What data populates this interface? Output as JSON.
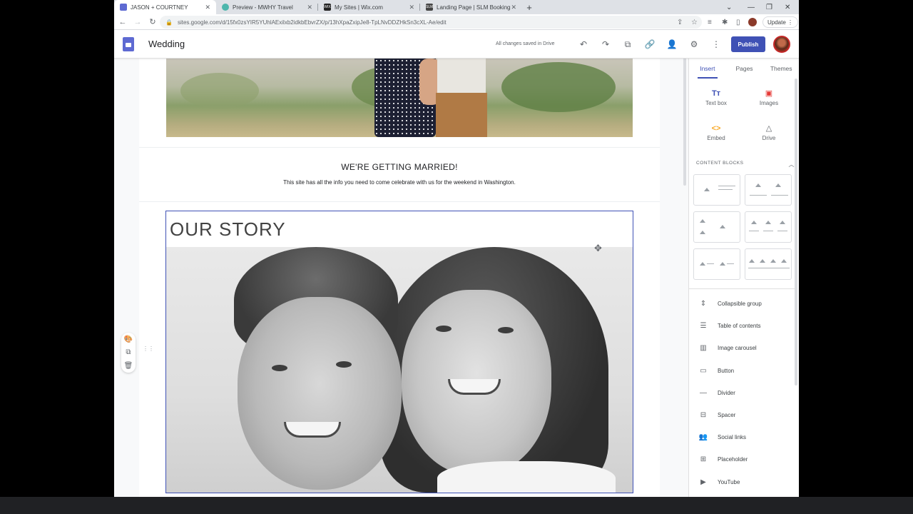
{
  "browser": {
    "tabs": [
      {
        "title": "JASON + COURTNEY",
        "color": "#5e6ad2"
      },
      {
        "title": "Preview - MWHY Travel",
        "color": "#4db6ac"
      },
      {
        "title": "My Sites | Wix.com",
        "color": "#222222"
      },
      {
        "title": "Landing Page | SLM Bookings",
        "color": "#444444"
      }
    ],
    "url": "sites.google.com/d/15fx0zsYIR5YUhlAExilxb2idkbEbvrZX/p/13hXpaZxipJe8-TpLNvDDZHkSn3cXL-Ae/edit",
    "update_label": "Update"
  },
  "editor": {
    "site_title": "Wedding",
    "saved_status": "All changes saved in Drive",
    "publish_label": "Publish"
  },
  "page": {
    "married_title": "WE'RE GETTING MARRIED!",
    "married_sub": "This site has all the info you need to come celebrate with us for the weekend in Washington.",
    "story_title": "OUR STORY"
  },
  "panel": {
    "tabs": [
      "Insert",
      "Pages",
      "Themes"
    ],
    "insert_items": [
      {
        "label": "Text box",
        "icon": "Tт"
      },
      {
        "label": "Images",
        "icon": "▣"
      },
      {
        "label": "Embed",
        "icon": "<>"
      },
      {
        "label": "Drive",
        "icon": "△"
      }
    ],
    "content_blocks_label": "CONTENT BLOCKS",
    "components": [
      {
        "label": "Collapsible group",
        "icon": "⇕"
      },
      {
        "label": "Table of contents",
        "icon": "☰"
      },
      {
        "label": "Image carousel",
        "icon": "▥"
      },
      {
        "label": "Button",
        "icon": "▭"
      },
      {
        "label": "Divider",
        "icon": "—"
      },
      {
        "label": "Spacer",
        "icon": "⊟"
      },
      {
        "label": "Social links",
        "icon": "👥"
      },
      {
        "label": "Placeholder",
        "icon": "⊞"
      },
      {
        "label": "YouTube",
        "icon": "▶"
      }
    ]
  }
}
